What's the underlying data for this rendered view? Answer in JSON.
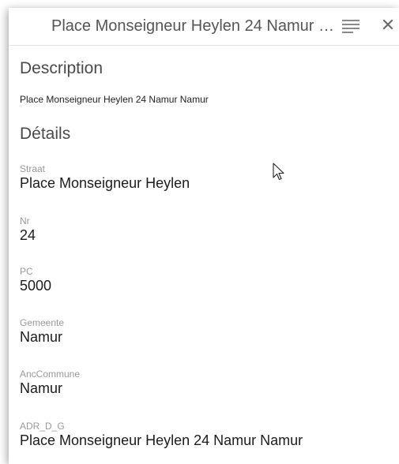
{
  "header": {
    "title": "Place Monseigneur Heylen 24 Namur Namur",
    "menu_icon": "hamburger-menu-icon",
    "close_icon": "close-icon"
  },
  "description": {
    "heading": "Description",
    "text": "Place Monseigneur Heylen 24 Namur Namur"
  },
  "details": {
    "heading": "Détails",
    "fields": [
      {
        "label": "Straat",
        "value": "Place Monseigneur Heylen"
      },
      {
        "label": "Nr",
        "value": "24"
      },
      {
        "label": "PC",
        "value": "5000"
      },
      {
        "label": "Gemeente",
        "value": "Namur"
      },
      {
        "label": "AncCommune",
        "value": "Namur"
      },
      {
        "label": "ADR_D_G",
        "value": "Place Monseigneur Heylen 24 Namur Namur"
      }
    ]
  }
}
